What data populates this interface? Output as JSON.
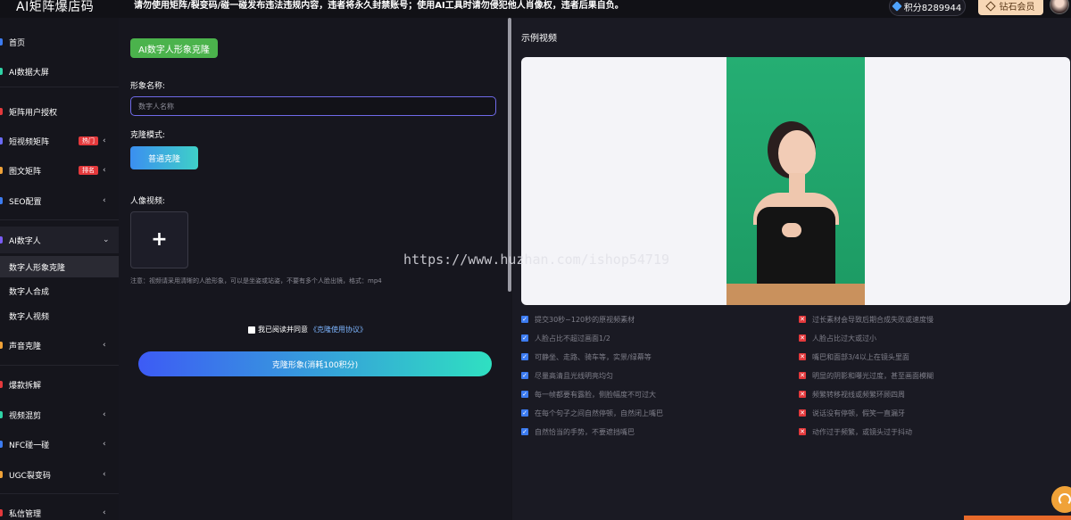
{
  "header": {
    "logo": "AI矩阵爆店码",
    "notice": "请勿使用矩阵/裂变码/碰一碰发布违法违规内容，违者将永久封禁账号；使用AI工具时请勿侵犯他人肖像权，违者后果自负。",
    "points": "积分8289944",
    "vip_label": "钻石会员"
  },
  "sidebar": {
    "items": [
      {
        "label": "首页",
        "icon": "home-icon",
        "color": "#3c7bf0"
      },
      {
        "label": "AI数据大屏",
        "icon": "dashboard-icon",
        "color": "#2fd3a6"
      },
      {
        "label": "矩阵用户授权",
        "icon": "auth-icon",
        "color": "#e4393c"
      },
      {
        "label": "短视频矩阵",
        "icon": "video-icon",
        "color": "#6b6bf5",
        "badge": "热门"
      },
      {
        "label": "图文矩阵",
        "icon": "image-text-icon",
        "color": "#f0a238",
        "badge": "排名"
      },
      {
        "label": "SEO配置",
        "icon": "seo-icon",
        "color": "#3c7bf0"
      },
      {
        "label": "AI数字人",
        "icon": "digital-human-icon",
        "color": "#7a5cf5"
      },
      {
        "label": "声音克隆",
        "icon": "voice-icon",
        "color": "#f0a238"
      },
      {
        "label": "爆款拆解",
        "icon": "analysis-icon",
        "color": "#e4393c"
      },
      {
        "label": "视频混剪",
        "icon": "mix-icon",
        "color": "#2fd3a6"
      },
      {
        "label": "NFC碰一碰",
        "icon": "nfc-icon",
        "color": "#3c7bf0"
      },
      {
        "label": "UGC裂变码",
        "icon": "ugc-icon",
        "color": "#f0a238"
      },
      {
        "label": "私信管理",
        "icon": "message-icon",
        "color": "#e4393c"
      }
    ],
    "sub_items": [
      "数字人形象克隆",
      "数字人合成",
      "数字人视频"
    ]
  },
  "form": {
    "title": "AI数字人形象克隆",
    "name_label": "形象名称:",
    "name_placeholder": "数字人名称",
    "mode_label": "克隆模式:",
    "mode_button": "普通克隆",
    "video_label": "人像视频:",
    "hint": "注意：视频请采用清晰的人脸形象，可以是坐姿或站姿，不要有多个人脸出镜，格式：mp4",
    "agree_text": "我已阅读并同意",
    "agree_link": "《克隆使用协议》",
    "submit": "克隆形象(消耗100积分)"
  },
  "example": {
    "title": "示例视频",
    "do_list": [
      "提交30秒~120秒的原视频素材",
      "人脸占比不超过画面1/2",
      "可静坐、走路、骑车等，实景/绿幕等",
      "尽量高清且光线明亮均匀",
      "每一帧都要有露脸，侧脸幅度不可过大",
      "在每个句子之间自然停顿，自然闭上嘴巴",
      "自然恰当的手势，不要遮挡嘴巴"
    ],
    "dont_list": [
      "过长素材会导致后期合成失败或速度慢",
      "人脸占比过大或过小",
      "嘴巴和面部3/4以上在镜头里面",
      "明显的阴影和曝光过度，甚至画面模糊",
      "频繁转移视线或频繁环顾四周",
      "说话没有停顿，假笑一直漏牙",
      "动作过于频繁，或镜头过于抖动"
    ]
  },
  "watermark": "https://www.huzhan.com/ishop54719"
}
